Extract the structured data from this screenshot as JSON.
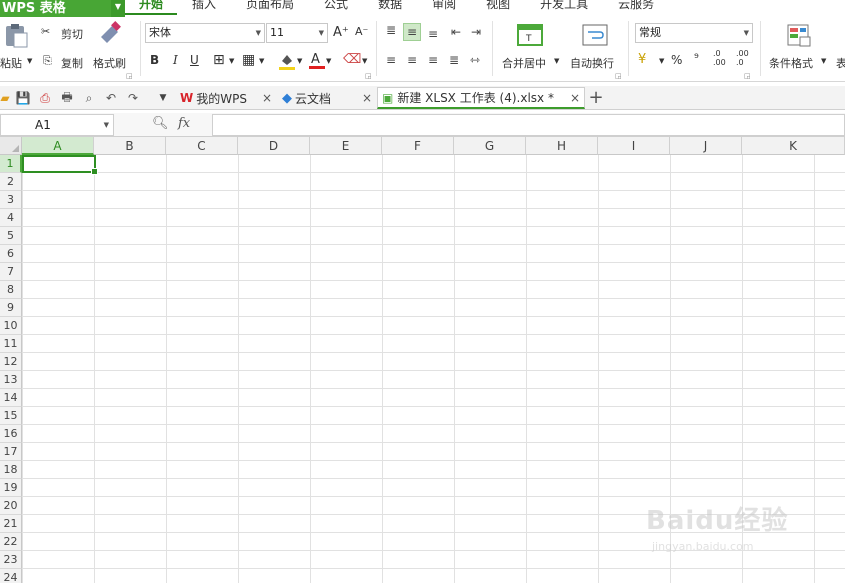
{
  "app": {
    "title": "WPS 表格",
    "accent": "#48a635"
  },
  "menu": {
    "items": [
      "开始",
      "插入",
      "页面布局",
      "公式",
      "数据",
      "审阅",
      "视图",
      "开发工具",
      "云服务"
    ],
    "active": "开始"
  },
  "ribbon": {
    "paste_label": "粘贴",
    "cut_label": "剪切",
    "copy_label": "复制",
    "format_painter_label": "格式刷",
    "font_name": "宋体",
    "font_size": "11",
    "merge_label": "合并居中",
    "wrap_label": "自动换行",
    "number_format": "常规",
    "percent": "%",
    "comma": "⁹",
    "inc_decimal": ".0 .00",
    "dec_decimal": ".00 .0",
    "cond_format_label": "条件格式",
    "bold": "B",
    "italic": "I",
    "underline": "U",
    "grow_font": "A⁺",
    "shrink_font": "A⁻"
  },
  "tabs": {
    "items": [
      {
        "label": "我的WPS",
        "icon": "wps-logo-icon"
      },
      {
        "label": "云文档",
        "icon": "cloud-doc-icon"
      },
      {
        "label": "新建 XLSX 工作表 (4).xlsx *",
        "icon": "spreadsheet-file-icon",
        "active": true
      }
    ],
    "new_tab": "+"
  },
  "formula_bar": {
    "name_box": "A1",
    "fx": "fx",
    "value": ""
  },
  "grid": {
    "columns": [
      "A",
      "B",
      "C",
      "D",
      "E",
      "F",
      "G",
      "H",
      "I",
      "J",
      "K"
    ],
    "rows": [
      "1",
      "2",
      "3",
      "4",
      "5",
      "6",
      "7",
      "8",
      "9",
      "10",
      "11",
      "12",
      "13",
      "14",
      "15",
      "16",
      "17",
      "18",
      "19",
      "20",
      "21",
      "22",
      "23",
      "24"
    ],
    "selected_column": "A",
    "selected_row": "1"
  },
  "watermark": {
    "logo": "Baidu经验",
    "url": "jingyan.baidu.com"
  }
}
